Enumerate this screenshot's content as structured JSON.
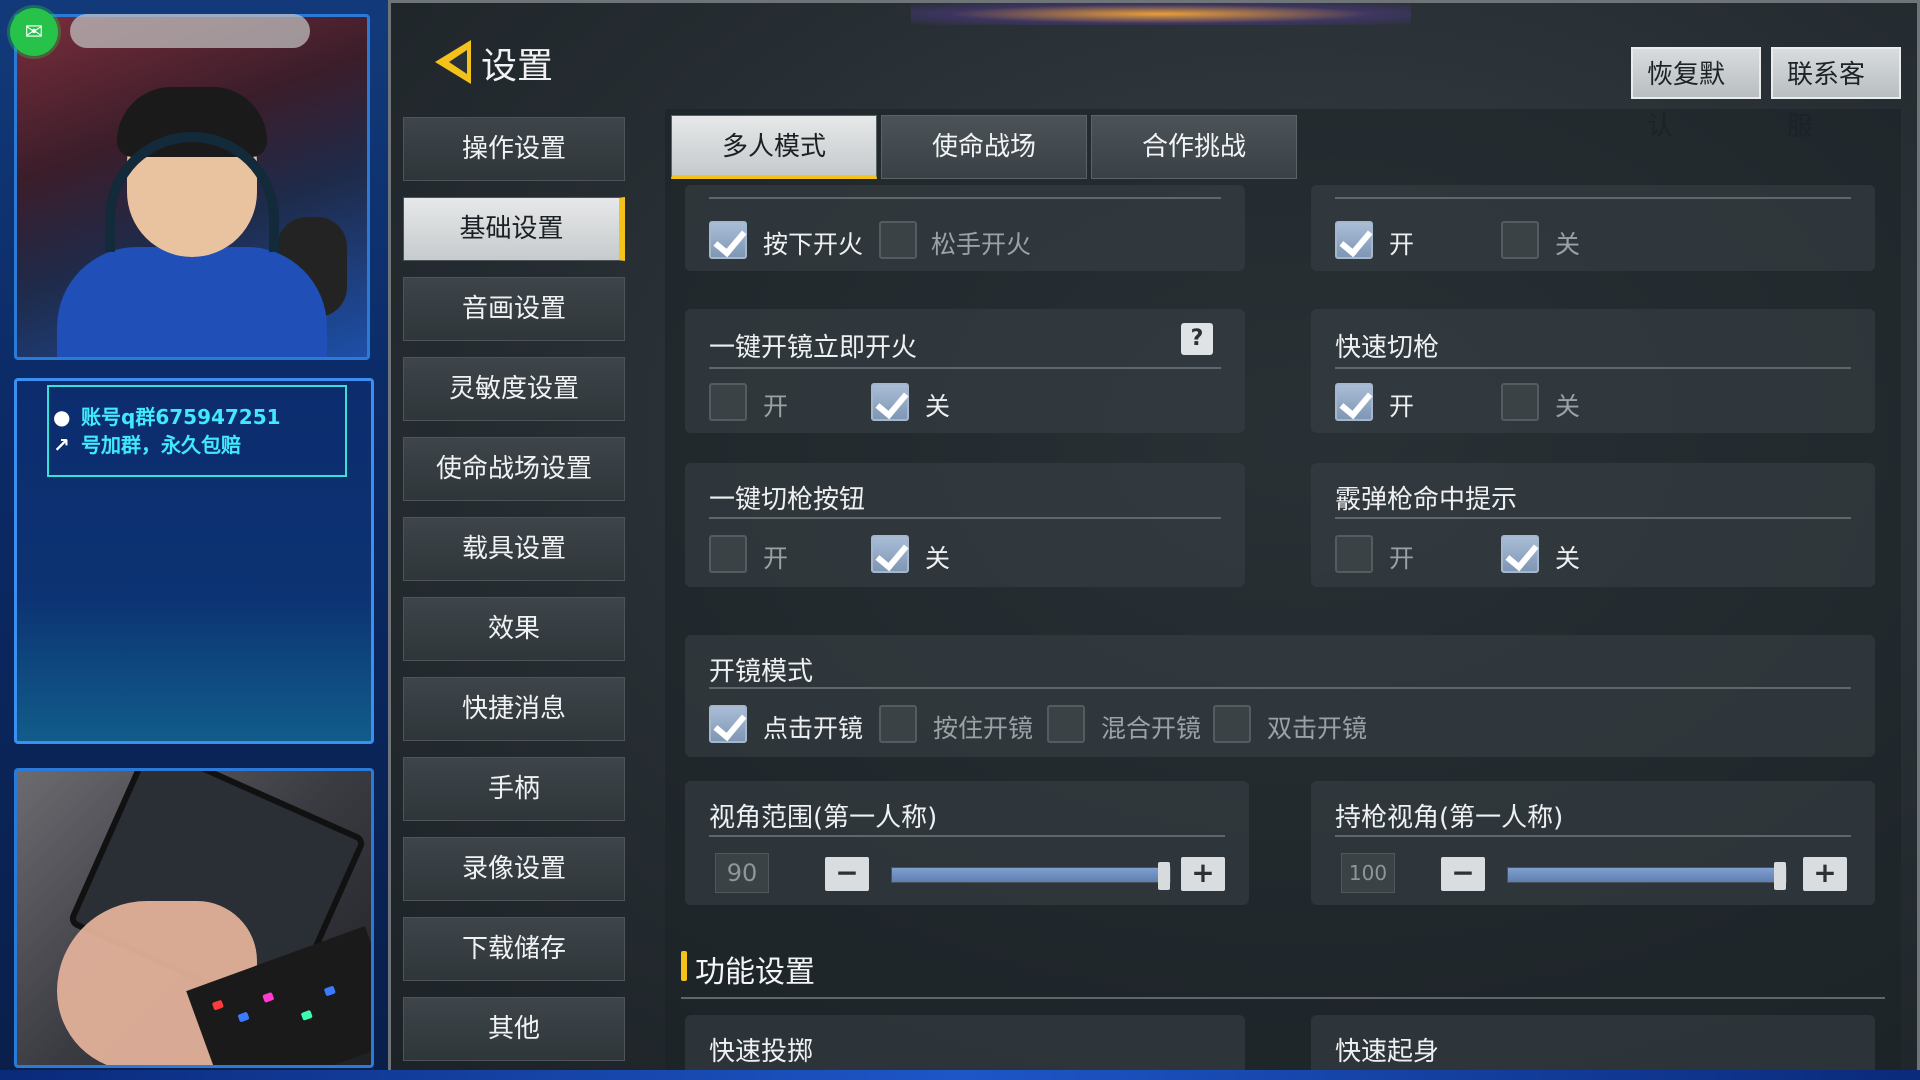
{
  "overlay": {
    "info_line1": "账号q群675947251",
    "info_line2": "号加群，永久包赔",
    "icons": {
      "wechat": "wechat-icon",
      "qq": "qq-icon",
      "wrench": "wrench-icon"
    }
  },
  "header": {
    "title": "设置",
    "reset_label": "恢复默认",
    "contact_label": "联系客服"
  },
  "sidebar": {
    "items": [
      {
        "label": "操作设置",
        "active": false
      },
      {
        "label": "基础设置",
        "active": true
      },
      {
        "label": "音画设置",
        "active": false
      },
      {
        "label": "灵敏度设置",
        "active": false
      },
      {
        "label": "使命战场设置",
        "active": false
      },
      {
        "label": "载具设置",
        "active": false
      },
      {
        "label": "效果",
        "active": false
      },
      {
        "label": "快捷消息",
        "active": false
      },
      {
        "label": "手柄",
        "active": false
      },
      {
        "label": "录像设置",
        "active": false
      },
      {
        "label": "下载储存",
        "active": false
      },
      {
        "label": "其他",
        "active": false
      }
    ]
  },
  "tabs": [
    {
      "label": "多人模式",
      "active": true
    },
    {
      "label": "使命战场",
      "active": false
    },
    {
      "label": "合作挑战",
      "active": false
    }
  ],
  "settings": {
    "fire_mode": {
      "opt1": "按下开火",
      "opt2": "松手开火",
      "selected": "按下开火"
    },
    "top_right": {
      "opt1": "开",
      "opt2": "关",
      "selected": "开"
    },
    "ads_fire": {
      "title": "一键开镜立即开火",
      "opt1": "开",
      "opt2": "关",
      "selected": "关",
      "help": "?"
    },
    "quick_switch": {
      "title": "快速切枪",
      "opt1": "开",
      "opt2": "关",
      "selected": "开"
    },
    "switch_button": {
      "title": "一键切枪按钮",
      "opt1": "开",
      "opt2": "关",
      "selected": "关"
    },
    "shotgun_hint": {
      "title": "霰弹枪命中提示",
      "opt1": "开",
      "opt2": "关",
      "selected": "关"
    },
    "scope_mode": {
      "title": "开镜模式",
      "options": [
        "点击开镜",
        "按住开镜",
        "混合开镜",
        "双击开镜"
      ],
      "selected": "点击开镜"
    },
    "fov": {
      "title": "视角范围(第一人称)",
      "value": "90",
      "fill_fraction": 1.0,
      "minus": "−",
      "plus": "+"
    },
    "weapon_fov": {
      "title": "持枪视角(第一人称)",
      "value": "100",
      "fill_fraction": 1.0,
      "minus": "−",
      "plus": "+"
    }
  },
  "function_section": {
    "title": "功能设置",
    "items": [
      "快速投掷",
      "快速起身"
    ]
  },
  "colors": {
    "accent": "#f4c21a",
    "overlay_text": "#41e9ff",
    "checkbox_on": "#8ea5c2"
  }
}
